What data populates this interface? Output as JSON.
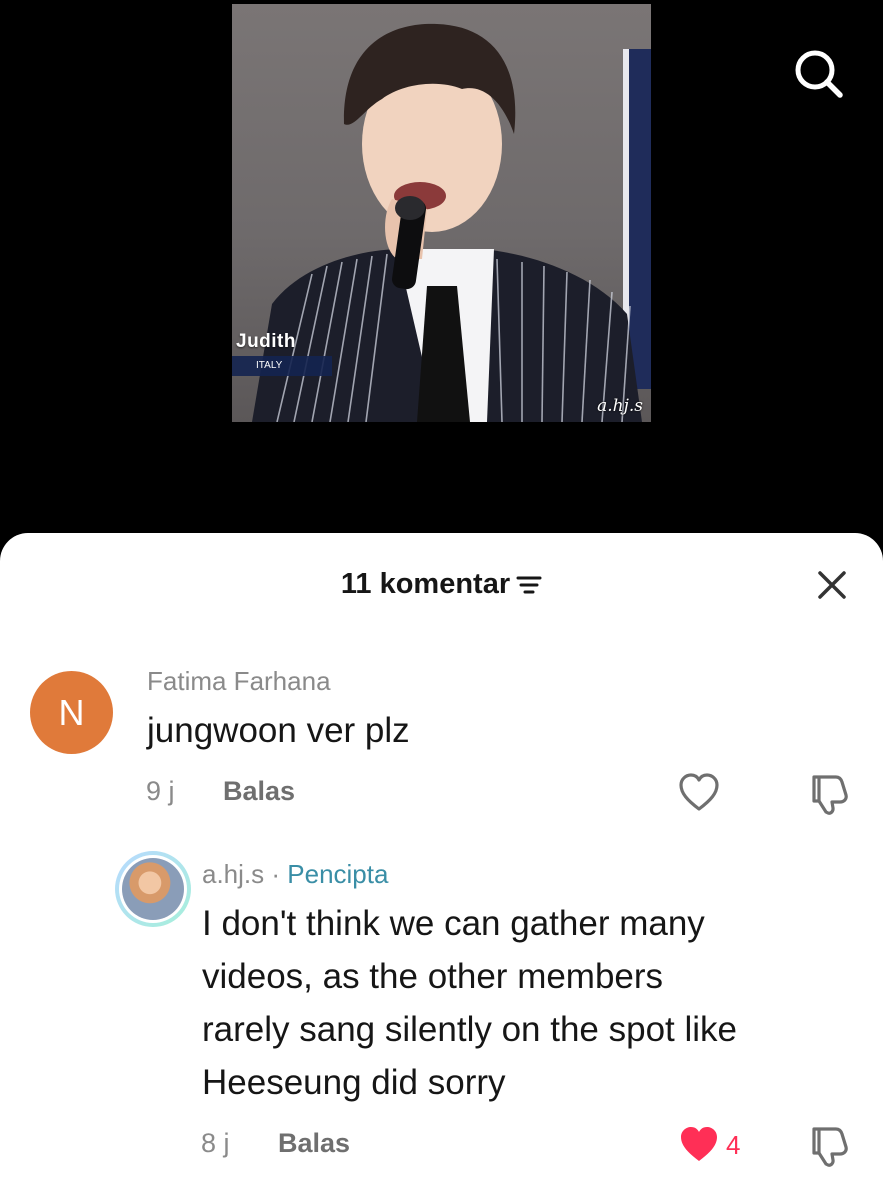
{
  "video": {
    "name_overlay": "Judith",
    "country_overlay": "ITALY",
    "watermark": "a.hj.s"
  },
  "header": {
    "comment_count_label": "11 komentar"
  },
  "comments": [
    {
      "avatar_letter": "N",
      "author": "Fatima Farhana",
      "text": "jungwoon ver plz",
      "time": "9 j",
      "reply_label": "Balas",
      "liked": false
    },
    {
      "author": "a.hj.s",
      "separator": " · ",
      "creator_badge": "Pencipta",
      "text_lines": [
        "I don't think we can gather many",
        "videos, as the other members",
        "rarely sang silently on the spot like",
        "Heeseung did sorry"
      ],
      "time": "8 j",
      "reply_label": "Balas",
      "liked": true,
      "like_count": "4"
    }
  ],
  "colors": {
    "accent_like": "#ff2f56",
    "creator_badge": "#3a8ea6",
    "avatar_n_bg": "#e07a3a"
  },
  "icons": [
    "search-icon",
    "filter-icon",
    "close-icon",
    "heart-icon",
    "dislike-icon"
  ]
}
